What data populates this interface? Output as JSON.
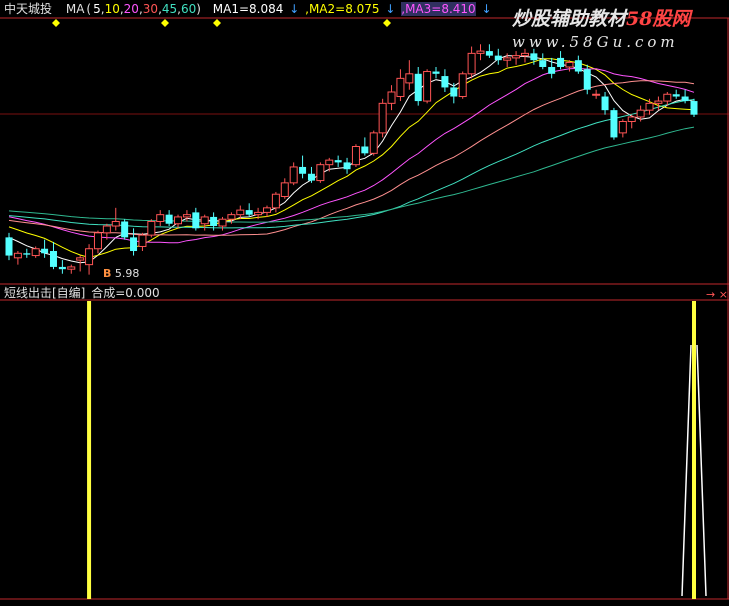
{
  "header": {
    "stock_name": "中天城投",
    "ma_label": "MA",
    "ma_open": "(",
    "ma_periods": [
      "5",
      "10",
      "20",
      "30",
      "45",
      "60"
    ],
    "ma_close": ")",
    "ma1": "MA1=8.084",
    "ma2": ",MA2=8.075",
    "ma3": ",MA3=8.410",
    "arrow": "↓"
  },
  "watermark": {
    "brand": "炒股辅助教材",
    "brand_highlight": "58股网",
    "url": "www.58Gu.com"
  },
  "upper_chart": {
    "low_marker": "B",
    "low_value": "5.98"
  },
  "indicator": {
    "name": "短线出击[自编]",
    "value_label": "合成=0.000",
    "arrows": "→ ×"
  },
  "colors": {
    "background": "#000000",
    "up": "#ff5555",
    "down": "#54ffff",
    "ma5": "#ffffff",
    "ma10": "#ffff00",
    "ma20": "#ff55ff",
    "ma30": "#00ff00",
    "ma45": "#ff9090",
    "ma60": "#40e0c0",
    "border": "#c0282c",
    "signal": "#ffff40"
  },
  "chart_data": {
    "type": "candlestick",
    "series": [
      {
        "name": "MA5",
        "type": "line"
      },
      {
        "name": "MA10",
        "type": "line"
      },
      {
        "name": "MA20",
        "type": "line"
      },
      {
        "name": "MA30",
        "type": "line"
      },
      {
        "name": "MA45",
        "type": "line"
      },
      {
        "name": "MA60",
        "type": "line"
      }
    ],
    "indicator": {
      "name": "短线出击[自编]",
      "value": 0.0,
      "signals_at_candle_index": [
        9,
        77
      ]
    }
  }
}
